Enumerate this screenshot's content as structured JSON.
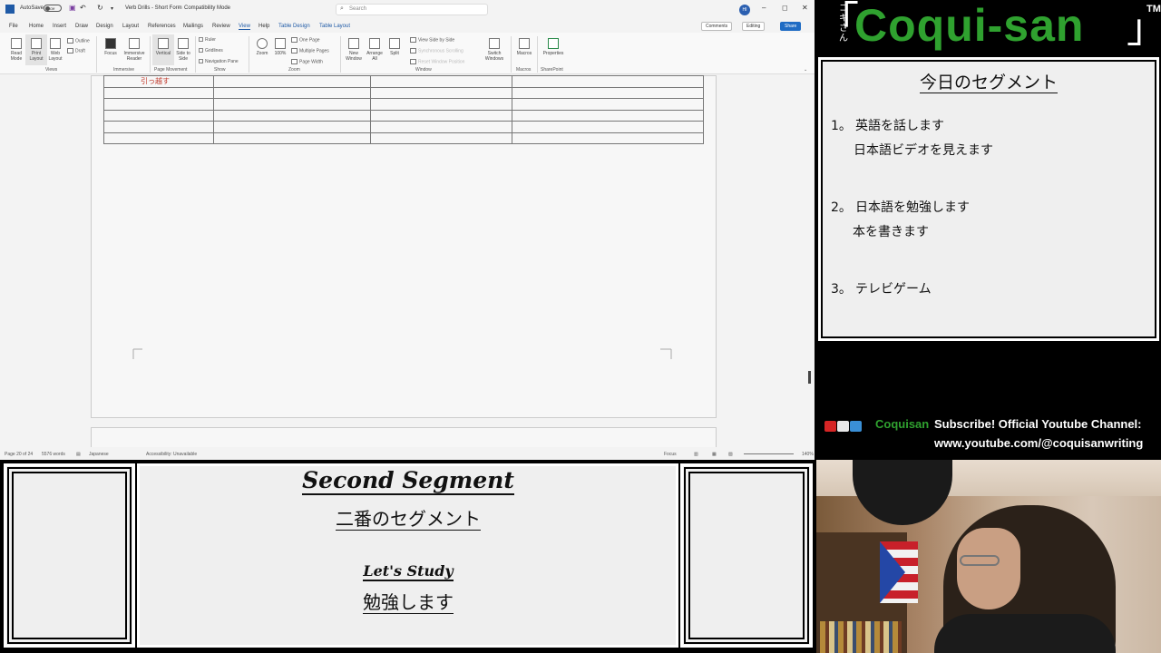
{
  "word": {
    "titlebar": {
      "autosave_label": "AutoSave",
      "autosave_state": "Off",
      "doc_title": "Verb Drills - Short Form",
      "mode": "Compatibility Mode",
      "search_placeholder": "Search",
      "user_initials": "HI"
    },
    "menu": {
      "tabs": [
        "File",
        "Home",
        "Insert",
        "Draw",
        "Design",
        "Layout",
        "References",
        "Mailings",
        "Review",
        "View",
        "Help",
        "Table Design",
        "Table Layout"
      ],
      "active_tab": "View",
      "comments_label": "Comments",
      "editing_label": "Editing",
      "share_label": "Share"
    },
    "ribbon": {
      "views": [
        "Read Mode",
        "Print Layout",
        "Web Layout"
      ],
      "views_small": [
        "Outline",
        "Draft"
      ],
      "immersive": [
        "Focus",
        "Immersive Reader"
      ],
      "page_movement": [
        "Vertical",
        "Side to Side"
      ],
      "show": [
        "Ruler",
        "Gridlines",
        "Navigation Pane"
      ],
      "zoom": [
        "Zoom",
        "100%"
      ],
      "zoom_small": [
        "One Page",
        "Multiple Pages",
        "Page Width"
      ],
      "window": [
        "New Window",
        "Arrange All",
        "Split"
      ],
      "window_small": [
        "View Side by Side",
        "Synchronous Scrolling",
        "Reset Window Position"
      ],
      "switch_windows": "Switch Windows",
      "macros": "Macros",
      "properties": "Properties",
      "groups": [
        "Views",
        "Immersive",
        "Page Movement",
        "Show",
        "Zoom",
        "Window",
        "Macros",
        "SharePoint"
      ]
    },
    "document": {
      "table_first_cell": "引っ越す"
    },
    "status": {
      "page": "Page 20 of 24",
      "words": "5576 words",
      "language": "Japanese",
      "accessibility": "Accessibility: Unavailable",
      "focus": "Focus",
      "zoom": "140%"
    }
  },
  "brand": {
    "kana": "コキさん",
    "title": "Coqui-san",
    "tm": "TM"
  },
  "segments": {
    "title": "今日のセグメント",
    "items": [
      {
        "num": "1。",
        "main": "英語を話します",
        "sub": "日本語ビデオを見えます"
      },
      {
        "num": "2。",
        "main": "日本語を勉強します",
        "sub": "本を書きます"
      },
      {
        "num": "3。",
        "main": "テレビゲーム",
        "sub": ""
      }
    ]
  },
  "social": {
    "name": "Coquisan",
    "line1": "Subscribe! Official Youtube Channel:",
    "line2": "www.youtube.com/@coquisanwriting",
    "icons": [
      "youtube-icon",
      "mobile-icon",
      "twitch-icon"
    ],
    "colors": {
      "brand_green": "#2fa12f"
    }
  },
  "bottom": {
    "title": "Second Segment",
    "subtitle": "二番のセグメント",
    "study_en": "Let's Study",
    "study_jp": "勉強します"
  }
}
